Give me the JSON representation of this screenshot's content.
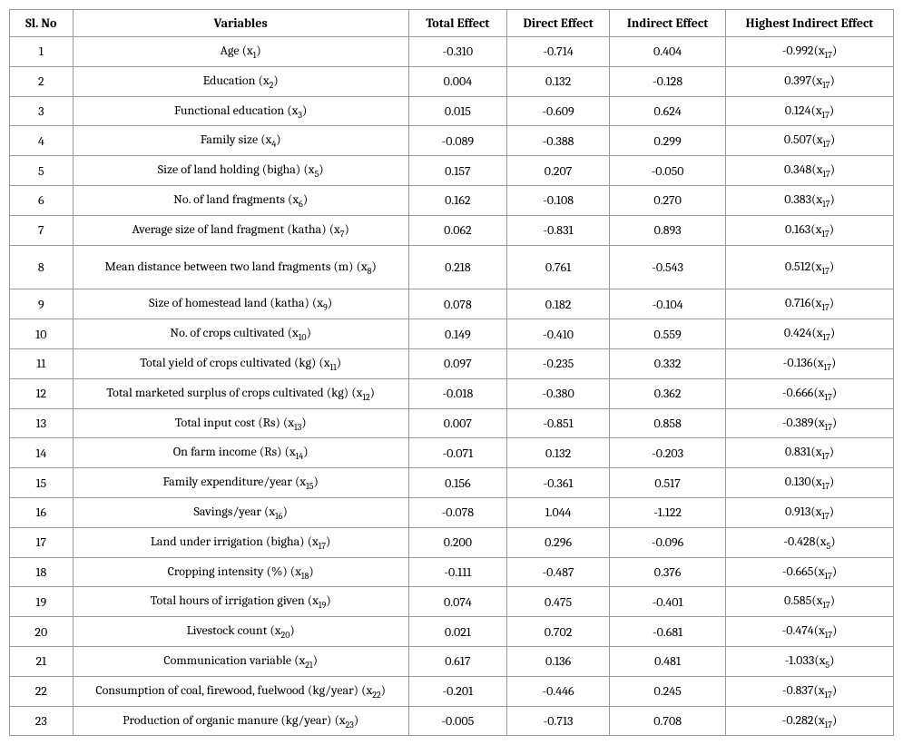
{
  "chart_data": {
    "type": "table",
    "title": "",
    "columns": [
      "Sl. No",
      "Variables",
      "Total Effect",
      "Direct Effect",
      "Indirect Effect",
      "Highest Indirect Effect"
    ],
    "rows": [
      {
        "sl": "1",
        "var": "Age (x",
        "var_sub": "1",
        "var_end": ")",
        "total": "-0.310",
        "direct": "-0.714",
        "indirect": "0.404",
        "highest": "-0.992(x",
        "highest_sub": "17",
        "highest_end": ")"
      },
      {
        "sl": "2",
        "var": "Education (x",
        "var_sub": "2",
        "var_end": ")",
        "total": "0.004",
        "direct": "0.132",
        "indirect": "-0.128",
        "highest": "0.397(x",
        "highest_sub": "17",
        "highest_end": ")"
      },
      {
        "sl": "3",
        "var": "Functional education (x",
        "var_sub": "3",
        "var_end": ")",
        "total": "0.015",
        "direct": "-0.609",
        "indirect": "0.624",
        "highest": "0.124(x",
        "highest_sub": "17",
        "highest_end": ")"
      },
      {
        "sl": "4",
        "var": "Family size (x",
        "var_sub": "4",
        "var_end": ")",
        "total": "-0.089",
        "direct": "-0.388",
        "indirect": "0.299",
        "highest": "0.507(x",
        "highest_sub": "17",
        "highest_end": ")"
      },
      {
        "sl": "5",
        "var": "Size of land holding (bigha) (x",
        "var_sub": "5",
        "var_end": ")",
        "total": "0.157",
        "direct": "0.207",
        "indirect": "-0.050",
        "highest": "0.348(x",
        "highest_sub": "17",
        "highest_end": ")"
      },
      {
        "sl": "6",
        "var": "No. of land fragments (x",
        "var_sub": "6",
        "var_end": ")",
        "total": "0.162",
        "direct": "-0.108",
        "indirect": "0.270",
        "highest": "0.383(x",
        "highest_sub": "17",
        "highest_end": ")"
      },
      {
        "sl": "7",
        "var": "Average size of land fragment (katha) (x",
        "var_sub": "7",
        "var_end": ")",
        "total": "0.062",
        "direct": "-0.831",
        "indirect": "0.893",
        "highest": "0.163(x",
        "highest_sub": "17",
        "highest_end": ")"
      },
      {
        "sl": "8",
        "var": "Mean distance between two land fragments (m) (x",
        "var_sub": "8",
        "var_end": ")",
        "total": "0.218",
        "direct": "0.761",
        "indirect": "-0.543",
        "highest": "0.512(x",
        "highest_sub": "17",
        "highest_end": ")",
        "tall": true
      },
      {
        "sl": "9",
        "var": "Size of homestead land (katha) (x",
        "var_sub": "9",
        "var_end": ")",
        "total": "0.078",
        "direct": "0.182",
        "indirect": "-0.104",
        "highest": "0.716(x",
        "highest_sub": "17",
        "highest_end": ")"
      },
      {
        "sl": "10",
        "var": "No. of crops cultivated (x",
        "var_sub": "10",
        "var_end": ")",
        "total": "0.149",
        "direct": "-0.410",
        "indirect": "0.559",
        "highest": "0.424(x",
        "highest_sub": "17",
        "highest_end": ")"
      },
      {
        "sl": "11",
        "var": "Total yield of crops cultivated (kg) (x",
        "var_sub": "11",
        "var_end": ")",
        "total": "0.097",
        "direct": "-0.235",
        "indirect": "0.332",
        "highest": "-0.136(x",
        "highest_sub": "17",
        "highest_end": ")"
      },
      {
        "sl": "12",
        "var": "Total marketed surplus of crops cultivated (kg) (x",
        "var_sub": "12",
        "var_end": ")",
        "total": "-0.018",
        "direct": "-0.380",
        "indirect": "0.362",
        "highest": "-0.666(x",
        "highest_sub": "17",
        "highest_end": ")"
      },
      {
        "sl": "13",
        "var": "Total input cost (Rs) (x",
        "var_sub": "13",
        "var_end": ")",
        "total": "0.007",
        "direct": "-0.851",
        "indirect": "0.858",
        "highest": "-0.389(x",
        "highest_sub": "17",
        "highest_end": ")"
      },
      {
        "sl": "14",
        "var": "On farm income (Rs) (x",
        "var_sub": "14",
        "var_end": ")",
        "total": "-0.071",
        "direct": "0.132",
        "indirect": "-0.203",
        "highest": "0.831(x",
        "highest_sub": "17",
        "highest_end": ")"
      },
      {
        "sl": "15",
        "var": "Family expenditure/year (x",
        "var_sub": "15",
        "var_end": ")",
        "total": "0.156",
        "direct": "-0.361",
        "indirect": "0.517",
        "highest": "0.130(x",
        "highest_sub": "17",
        "highest_end": ")"
      },
      {
        "sl": "16",
        "var": "Savings/year (x",
        "var_sub": "16",
        "var_end": ")",
        "total": "-0.078",
        "direct": "1.044",
        "indirect": "-1.122",
        "highest": "0.913(x",
        "highest_sub": "17",
        "highest_end": ")"
      },
      {
        "sl": "17",
        "var": "Land under irrigation (bigha) (x",
        "var_sub": "17",
        "var_end": ")",
        "total": "0.200",
        "direct": "0.296",
        "indirect": "-0.096",
        "highest": "-0.428(x",
        "highest_sub": "5",
        "highest_end": ")"
      },
      {
        "sl": "18",
        "var": "Cropping intensity (%) (x",
        "var_sub": "18",
        "var_end": ")",
        "total": "-0.111",
        "direct": "-0.487",
        "indirect": "0.376",
        "highest": "-0.665(x",
        "highest_sub": "17",
        "highest_end": ")"
      },
      {
        "sl": "19",
        "var": "Total hours of irrigation given (x",
        "var_sub": "19",
        "var_end": ")",
        "total": "0.074",
        "direct": "0.475",
        "indirect": "-0.401",
        "highest": "0.585(x",
        "highest_sub": "17",
        "highest_end": ")"
      },
      {
        "sl": "20",
        "var": "Livestock count (x",
        "var_sub": "20",
        "var_end": ")",
        "total": "0.021",
        "direct": "0.702",
        "indirect": "-0.681",
        "highest": "-0.474(x",
        "highest_sub": "17",
        "highest_end": ")"
      },
      {
        "sl": "21",
        "var": "Communication variable (x",
        "var_sub": "21",
        "var_end": ")",
        "total": "0.617",
        "direct": "0.136",
        "indirect": "0.481",
        "highest": "-1.033(x",
        "highest_sub": "5",
        "highest_end": ")"
      },
      {
        "sl": "22",
        "var": "Consumption of coal, firewood, fuelwood (kg/year) (x",
        "var_sub": "22",
        "var_end": ")",
        "total": "-0.201",
        "direct": "-0.446",
        "indirect": "0.245",
        "highest": "-0.837(x",
        "highest_sub": "17",
        "highest_end": ")"
      },
      {
        "sl": "23",
        "var": "Production of organic manure (kg/year) (x",
        "var_sub": "23",
        "var_end": ")",
        "total": "-0.005",
        "direct": "-0.713",
        "indirect": "0.708",
        "highest": "-0.282(x",
        "highest_sub": "17",
        "highest_end": ")"
      }
    ]
  },
  "headers": {
    "slno": "Sl. No",
    "variables": "Variables",
    "total": "Total Effect",
    "direct": "Direct Effect",
    "indirect": "Indirect Effect",
    "highest": "Highest Indirect Effect"
  }
}
